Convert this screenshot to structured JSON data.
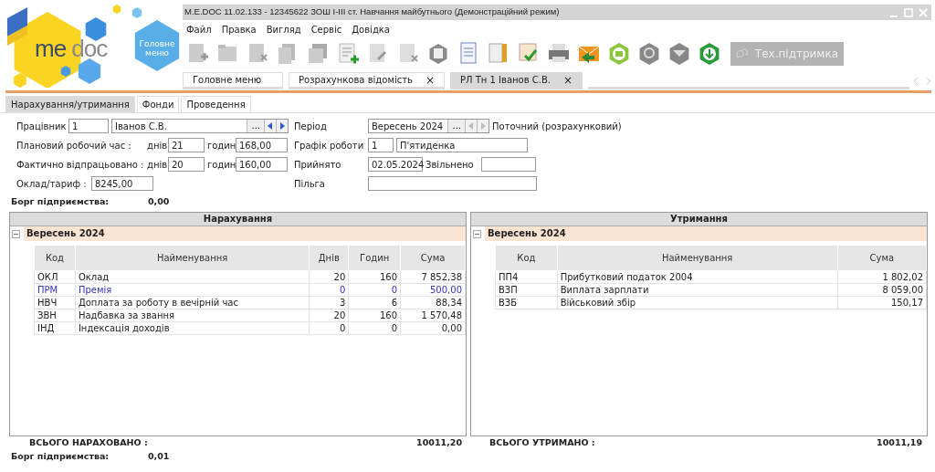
{
  "logo": {
    "parts": [
      "me",
      "doc"
    ],
    "home": "Головне меню"
  },
  "window": {
    "title": "M.E.DOC 11.02.133  - 12345622 ЗОШ І-ІІІ ст. Навчання майбутнього (Демонстраційний режим)"
  },
  "menu": [
    "Файл",
    "Правка",
    "Вигляд",
    "Сервіс",
    "Довідка"
  ],
  "support_button": "Тех.підтримка",
  "doc_tabs": [
    {
      "label": "Головне меню",
      "selected": false
    },
    {
      "label": "Розрахункова відомість",
      "close": "×",
      "selected": false
    },
    {
      "label": "РЛ Тн 1 Іванов С.В.",
      "close": "×",
      "selected": true
    }
  ],
  "sub_tabs": [
    {
      "label": "Нарахування/утримання",
      "selected": true
    },
    {
      "label": "Фонди",
      "selected": false
    },
    {
      "label": "Проведення",
      "selected": false
    }
  ],
  "form": {
    "employee": {
      "label": "Працівник",
      "id": "1",
      "name": "Іванов С.В.",
      "browse": "...",
      "arrows_disabled": false
    },
    "planned": {
      "label": "Плановий робочий час :",
      "days_label": "днів",
      "days": "21",
      "hours_label": "годин",
      "hours": "168,00"
    },
    "actual": {
      "label": "Фактично відпрацьовано :",
      "days_label": "днів",
      "days": "20",
      "hours_label": "годин",
      "hours": "160,00"
    },
    "salary": {
      "label": "Оклад/тариф :",
      "value": "8245,00"
    },
    "period": {
      "label": "Період",
      "value": "Вересень 2024",
      "browse": "...",
      "arrows_disabled": true,
      "note": "Поточний (розрахунковий)"
    },
    "schedule": {
      "label": "Графік роботи",
      "id": "1",
      "name": "П'ятиденка"
    },
    "hired": {
      "label": "Прийнято",
      "value": "02.05.2024",
      "fired_label": "Звільнено"
    },
    "benefit": {
      "label": "Пільга"
    }
  },
  "debt_top": {
    "label": "Борг підприємства:",
    "value": "0,00"
  },
  "accruals": {
    "title": "Нарахування",
    "group": "Вересень 2024",
    "expanded": true,
    "columns": [
      "Код",
      "Найменування",
      "Днів",
      "Годин",
      "Сума"
    ],
    "rows": [
      {
        "cells": [
          "ОКЛ",
          "Оклад",
          "20",
          "160",
          "7 852,38"
        ],
        "highlighted": false
      },
      {
        "cells": [
          "ПРМ",
          "Премія",
          "0",
          "0",
          "500,00"
        ],
        "highlighted": true
      },
      {
        "cells": [
          "НВЧ",
          "Доплата за роботу в вечірній час",
          "3",
          "6",
          "88,34"
        ],
        "highlighted": false
      },
      {
        "cells": [
          "ЗВН",
          "Надбавка за звання",
          "20",
          "160",
          "1 570,48"
        ],
        "highlighted": false
      },
      {
        "cells": [
          "ІНД",
          "Індексація доходів",
          "0",
          "0",
          "0,00"
        ],
        "highlighted": false
      }
    ],
    "total_label": "ВСЬОГО НАРАХОВАНО :",
    "total": "10011,20"
  },
  "deductions": {
    "title": "Утримання",
    "group": "Вересень 2024",
    "expanded": true,
    "columns": [
      "Код",
      "Найменування",
      "Сума"
    ],
    "rows": [
      {
        "cells": [
          "ПП4",
          "Прибутковий податок 2004",
          "1 802,02"
        ],
        "highlighted": false
      },
      {
        "cells": [
          "ВЗП",
          "Виплата зарплати",
          "8 059,00"
        ],
        "highlighted": false
      },
      {
        "cells": [
          "ВЗБ",
          "Військовий збір",
          "150,17"
        ],
        "highlighted": false
      }
    ],
    "total_label": "ВСЬОГО УТРИМАНО :",
    "total": "10011,19"
  },
  "debt_bottom": {
    "label": "Борг підприємства:",
    "value": "0,01"
  }
}
